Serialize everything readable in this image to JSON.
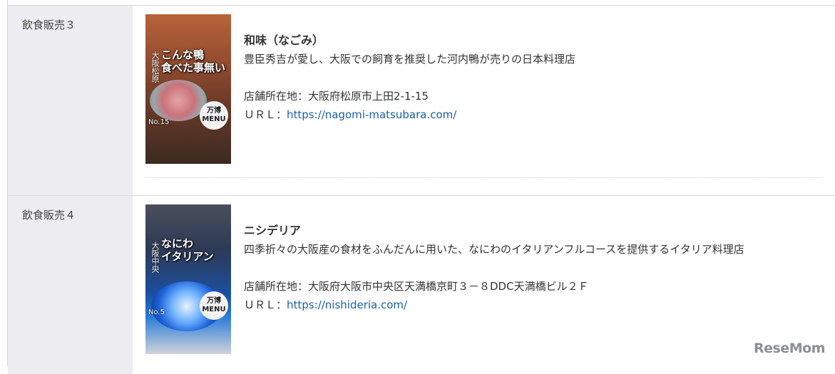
{
  "rows": [
    {
      "label": "飲食販売３",
      "thumb": {
        "title_line1": "こんな鴨",
        "title_line2": "食べた事無い",
        "side_text": "大阪松原",
        "badge_line1": "万博",
        "badge_line2": "MENU",
        "number": "No.15"
      },
      "name": "和味（なごみ）",
      "description": "豊臣秀吉が愛し、大阪での飼育を推奨した河内鴨が売りの日本料理店",
      "address": "店舗所在地：大阪府松原市上田2-1-15",
      "url_label": "ＵＲＬ：",
      "url": "https://nagomi-matsubara.com/"
    },
    {
      "label": "飲食販売４",
      "thumb": {
        "title_line1": "なにわ",
        "title_line2": "イタリアン",
        "side_text": "大阪中央",
        "badge_line1": "万博",
        "badge_line2": "MENU",
        "number": "No.5"
      },
      "name": "ニシデリア",
      "description": "四季折々の大阪産の食材をふんだんに用いた、なにわのイタリアンフルコースを提供するイタリア料理店",
      "address": "店舗所在地：大阪府大阪市中央区天満橋京町３－８DDC天満橋ビル２Ｆ",
      "url_label": "ＵＲＬ：",
      "url": "https://nishideria.com/"
    }
  ],
  "watermark": "ReseMom"
}
